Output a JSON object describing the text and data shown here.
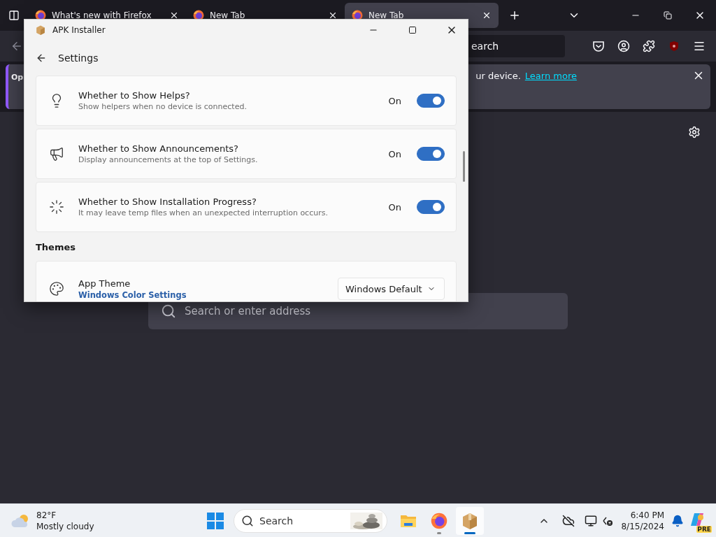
{
  "browser": {
    "tabs": [
      {
        "title": "What's new with Firefox",
        "selected": false
      },
      {
        "title": "New Tab",
        "selected": false
      },
      {
        "title": "New Tab",
        "selected": true
      }
    ],
    "address_bar": {
      "value": "earch"
    },
    "notification": {
      "start": "Op",
      "message": "ur device.",
      "link": "Learn more"
    },
    "search": {
      "placeholder": "Search or enter address"
    }
  },
  "app_window": {
    "title": "APK Installer",
    "page_title": "Settings",
    "settings": [
      {
        "title": "Whether to Show Helps?",
        "description": "Show helpers when no device is connected.",
        "state": "On",
        "on": true
      },
      {
        "title": "Whether to Show Announcements?",
        "description": "Display announcements at the top of Settings.",
        "state": "On",
        "on": true
      },
      {
        "title": "Whether to Show Installation Progress?",
        "description": "It may leave temp files when an unexpected interruption occurs.",
        "state": "On",
        "on": true
      }
    ],
    "section": "Themes",
    "theme": {
      "title": "App Theme",
      "link": "Windows Color Settings",
      "value": "Windows Default"
    }
  },
  "taskbar": {
    "weather": {
      "temp": "82°F",
      "condition": "Mostly cloudy"
    },
    "search_placeholder": "Search",
    "apps": [
      {
        "kind": "explorer",
        "selected": false,
        "running": false
      },
      {
        "kind": "firefox",
        "selected": false,
        "running": true
      },
      {
        "kind": "package",
        "selected": true,
        "running": true
      }
    ],
    "copilot_badge": "PRE",
    "time": "6:40 PM",
    "date": "8/15/2024"
  }
}
